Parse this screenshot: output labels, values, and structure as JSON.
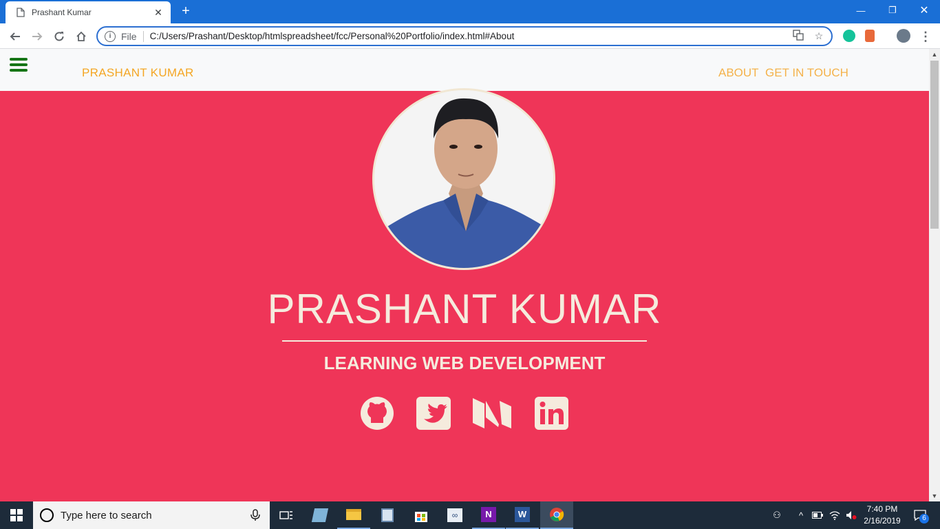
{
  "browser": {
    "tab_title": "Prashant Kumar",
    "tab_close": "✕",
    "new_tab": "+",
    "window_controls": {
      "minimize": "—",
      "restore": "❐",
      "close": "✕"
    },
    "url_scheme_label": "File",
    "url": "C:/Users/Prashant/Desktop/htmlspreadsheet/fcc/Personal%20Portfolio/index.html#About"
  },
  "site": {
    "brand": "PRASHANT KUMAR",
    "nav": {
      "about": "ABOUT",
      "contact": "GET IN TOUCH"
    },
    "hero": {
      "name": "PRASHANT KUMAR",
      "subtitle": "LEARNING WEB DEVELOPMENT",
      "social_icons": [
        "github-icon",
        "twitter-icon",
        "medium-icon",
        "linkedin-icon"
      ]
    },
    "colors": {
      "hero_bg": "#ef3558",
      "accent": "#f4a623",
      "text_cream": "#f5ebdd",
      "hamburger": "#157515"
    }
  },
  "taskbar": {
    "search_placeholder": "Type here to search",
    "time": "7:40 PM",
    "date": "2/16/2019",
    "notifications": "6"
  }
}
